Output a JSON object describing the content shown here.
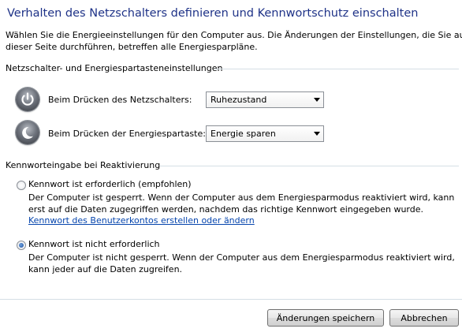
{
  "title": "Verhalten des Netzschalters definieren und Kennwortschutz einschalten",
  "intro": [
    "Wählen Sie die Energieeinstellungen für den Computer aus. Die Änderungen der Einstellungen, die Sie auf",
    "dieser Seite durchführen, betreffen alle Energiesparpläne."
  ],
  "power_section": {
    "heading": "Netzschalter- und Energiespartasteneinstellungen",
    "power_button": {
      "icon": "power-icon",
      "label": "Beim Drücken des Netzschalters:",
      "value": "Ruhezustand"
    },
    "sleep_button": {
      "icon": "sleep-moon-icon",
      "label": "Beim Drücken der Energiespartaste:",
      "value": "Energie sparen"
    }
  },
  "password_section": {
    "heading": "Kennworteingabe bei Reaktivierung",
    "option_required": {
      "label": "Kennwort ist erforderlich (empfohlen)",
      "checked": false,
      "description": [
        "Der Computer ist gesperrt. Wenn der Computer aus dem Energiesparmodus reaktiviert wird, kann",
        "erst auf die Daten zugegriffen werden, nachdem das richtige Kennwort eingegeben wurde."
      ],
      "link": "Kennwort des Benutzerkontos erstellen oder ändern"
    },
    "option_not_required": {
      "label": "Kennwort ist nicht erforderlich",
      "checked": true,
      "description": [
        "Der Computer ist nicht gesperrt. Wenn der Computer aus dem Energiesparmodus reaktiviert wird,",
        "kann jeder auf die Daten zugreifen."
      ]
    }
  },
  "footer": {
    "save_label": "Änderungen speichern",
    "cancel_label": "Abbrechen"
  },
  "colors": {
    "title": "#1e3287",
    "link": "#0645ad",
    "separator": "#d5dfe5"
  }
}
